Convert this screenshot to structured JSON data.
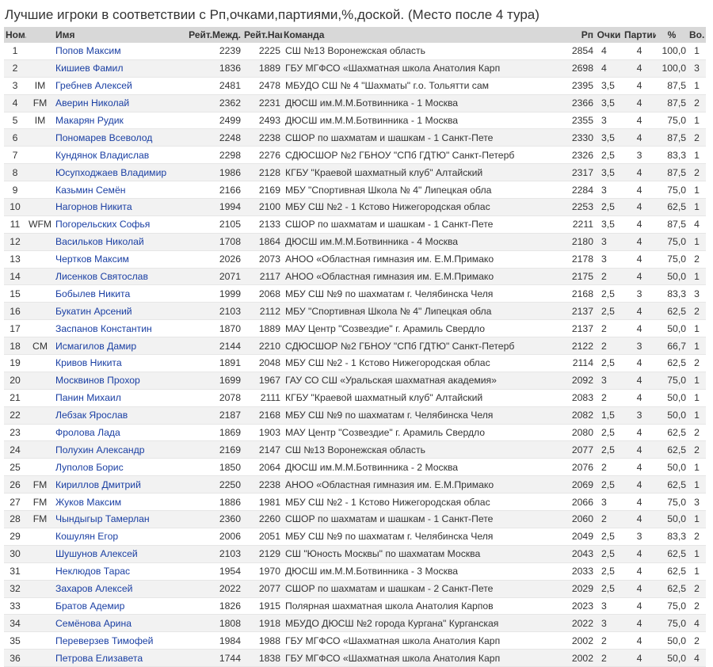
{
  "page": {
    "title": "Лучшие игроки в соответствии с Рп,очками,партиями,%,доской. (Место после 4 тура)"
  },
  "table": {
    "headers": {
      "num": "Ном.",
      "name": "Имя",
      "rating_int": "Рейт.Межд.",
      "rating_nat": "Рейт.Нац.",
      "team": "Команда",
      "rp": "Рп",
      "points": "Очки",
      "games": "Партии",
      "pct": "%",
      "board": "Во."
    },
    "rows": [
      {
        "num": "1",
        "title": "",
        "name": "Попов Максим",
        "rint": "2239",
        "rnat": "2225",
        "team": "СШ №13 Воронежская область",
        "rp": "2854",
        "pts": "4",
        "games": "4",
        "pct": "100,0",
        "bo": "1"
      },
      {
        "num": "2",
        "title": "",
        "name": "Кишиев Фамил",
        "rint": "1836",
        "rnat": "1889",
        "team": "ГБУ МГФСО «Шахматная школа Анатолия Карп",
        "rp": "2698",
        "pts": "4",
        "games": "4",
        "pct": "100,0",
        "bo": "3"
      },
      {
        "num": "3",
        "title": "IM",
        "name": "Гребнев Алексей",
        "rint": "2481",
        "rnat": "2478",
        "team": "МБУДО СШ № 4 \"Шахматы\" г.о. Тольятти сам",
        "rp": "2395",
        "pts": "3,5",
        "games": "4",
        "pct": "87,5",
        "bo": "1"
      },
      {
        "num": "4",
        "title": "FM",
        "name": "Аверин Николай",
        "rint": "2362",
        "rnat": "2231",
        "team": "ДЮСШ им.М.М.Ботвинника - 1 Москва",
        "rp": "2366",
        "pts": "3,5",
        "games": "4",
        "pct": "87,5",
        "bo": "2"
      },
      {
        "num": "5",
        "title": "IM",
        "name": "Макарян Рудик",
        "rint": "2499",
        "rnat": "2493",
        "team": "ДЮСШ им.М.М.Ботвинника - 1 Москва",
        "rp": "2355",
        "pts": "3",
        "games": "4",
        "pct": "75,0",
        "bo": "1"
      },
      {
        "num": "6",
        "title": "",
        "name": "Пономарев Всеволод",
        "rint": "2248",
        "rnat": "2238",
        "team": "СШОР по шахматам и шашкам - 1 Санкт-Пете",
        "rp": "2330",
        "pts": "3,5",
        "games": "4",
        "pct": "87,5",
        "bo": "2"
      },
      {
        "num": "7",
        "title": "",
        "name": "Кундянок Владислав",
        "rint": "2298",
        "rnat": "2276",
        "team": "СДЮСШОР №2 ГБНОУ \"СПб ГДТЮ\" Санкт-Петерб",
        "rp": "2326",
        "pts": "2,5",
        "games": "3",
        "pct": "83,3",
        "bo": "1"
      },
      {
        "num": "8",
        "title": "",
        "name": "Юсупходжаев Владимир",
        "rint": "1986",
        "rnat": "2128",
        "team": "КГБУ \"Краевой шахматный клуб\" Алтайский",
        "rp": "2317",
        "pts": "3,5",
        "games": "4",
        "pct": "87,5",
        "bo": "2"
      },
      {
        "num": "9",
        "title": "",
        "name": "Казьмин Семён",
        "rint": "2166",
        "rnat": "2169",
        "team": "МБУ \"Спортивная Школа № 4\" Липецкая обла",
        "rp": "2284",
        "pts": "3",
        "games": "4",
        "pct": "75,0",
        "bo": "1"
      },
      {
        "num": "10",
        "title": "",
        "name": "Нагорнов Никита",
        "rint": "1994",
        "rnat": "2100",
        "team": "МБУ СШ №2 - 1 Кстово Нижегородская облас",
        "rp": "2253",
        "pts": "2,5",
        "games": "4",
        "pct": "62,5",
        "bo": "1"
      },
      {
        "num": "11",
        "title": "WFM",
        "name": "Погорельских Софья",
        "rint": "2105",
        "rnat": "2133",
        "team": "СШОР по шахматам и шашкам - 1 Санкт-Пете",
        "rp": "2211",
        "pts": "3,5",
        "games": "4",
        "pct": "87,5",
        "bo": "4"
      },
      {
        "num": "12",
        "title": "",
        "name": "Васильков Николай",
        "rint": "1708",
        "rnat": "1864",
        "team": "ДЮСШ им.М.М.Ботвинника - 4 Москва",
        "rp": "2180",
        "pts": "3",
        "games": "4",
        "pct": "75,0",
        "bo": "1"
      },
      {
        "num": "13",
        "title": "",
        "name": "Чертков Максим",
        "rint": "2026",
        "rnat": "2073",
        "team": "АНОО «Областная гимназия им. Е.М.Примако",
        "rp": "2178",
        "pts": "3",
        "games": "4",
        "pct": "75,0",
        "bo": "2"
      },
      {
        "num": "14",
        "title": "",
        "name": "Лисенков Святослав",
        "rint": "2071",
        "rnat": "2117",
        "team": "АНОО «Областная гимназия им. Е.М.Примако",
        "rp": "2175",
        "pts": "2",
        "games": "4",
        "pct": "50,0",
        "bo": "1"
      },
      {
        "num": "15",
        "title": "",
        "name": "Бобылев Никита",
        "rint": "1999",
        "rnat": "2068",
        "team": "МБУ СШ №9 по шахматам г. Челябинска Челя",
        "rp": "2168",
        "pts": "2,5",
        "games": "3",
        "pct": "83,3",
        "bo": "3"
      },
      {
        "num": "16",
        "title": "",
        "name": "Букатин Арсений",
        "rint": "2103",
        "rnat": "2112",
        "team": "МБУ \"Спортивная Школа № 4\" Липецкая обла",
        "rp": "2137",
        "pts": "2,5",
        "games": "4",
        "pct": "62,5",
        "bo": "2"
      },
      {
        "num": "17",
        "title": "",
        "name": "Заспанов Константин",
        "rint": "1870",
        "rnat": "1889",
        "team": "МАУ Центр \"Созвездие\" г. Арамиль Свердло",
        "rp": "2137",
        "pts": "2",
        "games": "4",
        "pct": "50,0",
        "bo": "1"
      },
      {
        "num": "18",
        "title": "CM",
        "name": "Исмагилов Дамир",
        "rint": "2144",
        "rnat": "2210",
        "team": "СДЮСШОР №2 ГБНОУ \"СПб ГДТЮ\" Санкт-Петерб",
        "rp": "2122",
        "pts": "2",
        "games": "3",
        "pct": "66,7",
        "bo": "1"
      },
      {
        "num": "19",
        "title": "",
        "name": "Кривов Никита",
        "rint": "1891",
        "rnat": "2048",
        "team": "МБУ СШ №2 - 1 Кстово Нижегородская облас",
        "rp": "2114",
        "pts": "2,5",
        "games": "4",
        "pct": "62,5",
        "bo": "2"
      },
      {
        "num": "20",
        "title": "",
        "name": "Москвинов Прохор",
        "rint": "1699",
        "rnat": "1967",
        "team": "ГАУ СО СШ «Уральская шахматная академия»",
        "rp": "2092",
        "pts": "3",
        "games": "4",
        "pct": "75,0",
        "bo": "1"
      },
      {
        "num": "21",
        "title": "",
        "name": "Панин Михаил",
        "rint": "2078",
        "rnat": "2111",
        "team": "КГБУ \"Краевой шахматный клуб\" Алтайский",
        "rp": "2083",
        "pts": "2",
        "games": "4",
        "pct": "50,0",
        "bo": "1"
      },
      {
        "num": "22",
        "title": "",
        "name": "Лебзак Ярослав",
        "rint": "2187",
        "rnat": "2168",
        "team": "МБУ СШ №9 по шахматам г. Челябинска Челя",
        "rp": "2082",
        "pts": "1,5",
        "games": "3",
        "pct": "50,0",
        "bo": "1"
      },
      {
        "num": "23",
        "title": "",
        "name": "Фролова Лада",
        "rint": "1869",
        "rnat": "1903",
        "team": "МАУ Центр \"Созвездие\" г. Арамиль Свердло",
        "rp": "2080",
        "pts": "2,5",
        "games": "4",
        "pct": "62,5",
        "bo": "2"
      },
      {
        "num": "24",
        "title": "",
        "name": "Полухин Александр",
        "rint": "2169",
        "rnat": "2147",
        "team": "СШ №13 Воронежская область",
        "rp": "2077",
        "pts": "2,5",
        "games": "4",
        "pct": "62,5",
        "bo": "2"
      },
      {
        "num": "25",
        "title": "",
        "name": "Луполов Борис",
        "rint": "1850",
        "rnat": "2064",
        "team": "ДЮСШ им.М.М.Ботвинника - 2 Москва",
        "rp": "2076",
        "pts": "2",
        "games": "4",
        "pct": "50,0",
        "bo": "1"
      },
      {
        "num": "26",
        "title": "FM",
        "name": "Кириллов Дмитрий",
        "rint": "2250",
        "rnat": "2238",
        "team": "АНОО «Областная гимназия им. Е.М.Примако",
        "rp": "2069",
        "pts": "2,5",
        "games": "4",
        "pct": "62,5",
        "bo": "1"
      },
      {
        "num": "27",
        "title": "FM",
        "name": "Жуков Максим",
        "rint": "1886",
        "rnat": "1981",
        "team": "МБУ СШ №2 - 1 Кстово Нижегородская облас",
        "rp": "2066",
        "pts": "3",
        "games": "4",
        "pct": "75,0",
        "bo": "3"
      },
      {
        "num": "28",
        "title": "FM",
        "name": "Чындыгыр Тамерлан",
        "rint": "2360",
        "rnat": "2260",
        "team": "СШОР по шахматам и шашкам - 1 Санкт-Пете",
        "rp": "2060",
        "pts": "2",
        "games": "4",
        "pct": "50,0",
        "bo": "1"
      },
      {
        "num": "29",
        "title": "",
        "name": "Кошулян Егор",
        "rint": "2006",
        "rnat": "2051",
        "team": "МБУ СШ №9 по шахматам г. Челябинска Челя",
        "rp": "2049",
        "pts": "2,5",
        "games": "3",
        "pct": "83,3",
        "bo": "2"
      },
      {
        "num": "30",
        "title": "",
        "name": "Шушунов Алексей",
        "rint": "2103",
        "rnat": "2129",
        "team": "СШ \"Юность Москвы\" по шахматам Москва",
        "rp": "2043",
        "pts": "2,5",
        "games": "4",
        "pct": "62,5",
        "bo": "1"
      },
      {
        "num": "31",
        "title": "",
        "name": "Неклюдов Тарас",
        "rint": "1954",
        "rnat": "1970",
        "team": "ДЮСШ им.М.М.Ботвинника - 3 Москва",
        "rp": "2033",
        "pts": "2,5",
        "games": "4",
        "pct": "62,5",
        "bo": "1"
      },
      {
        "num": "32",
        "title": "",
        "name": "Захаров Алексей",
        "rint": "2022",
        "rnat": "2077",
        "team": "СШОР по шахматам и шашкам - 2 Санкт-Пете",
        "rp": "2029",
        "pts": "2,5",
        "games": "4",
        "pct": "62,5",
        "bo": "2"
      },
      {
        "num": "33",
        "title": "",
        "name": "Братов Адемир",
        "rint": "1826",
        "rnat": "1915",
        "team": "Полярная шахматная школа Анатолия Карпов",
        "rp": "2023",
        "pts": "3",
        "games": "4",
        "pct": "75,0",
        "bo": "2"
      },
      {
        "num": "34",
        "title": "",
        "name": "Семёнова Арина",
        "rint": "1808",
        "rnat": "1918",
        "team": "МБУДО ДЮСШ №2 города Кургана\" Курганская",
        "rp": "2022",
        "pts": "3",
        "games": "4",
        "pct": "75,0",
        "bo": "4"
      },
      {
        "num": "35",
        "title": "",
        "name": "Переверзев Тимофей",
        "rint": "1984",
        "rnat": "1988",
        "team": "ГБУ МГФСО «Шахматная школа Анатолия Карп",
        "rp": "2002",
        "pts": "2",
        "games": "4",
        "pct": "50,0",
        "bo": "2"
      },
      {
        "num": "36",
        "title": "",
        "name": "Петрова Елизавета",
        "rint": "1744",
        "rnat": "1838",
        "team": "ГБУ МГФСО «Шахматная школа Анатолия Карп",
        "rp": "2002",
        "pts": "2",
        "games": "4",
        "pct": "50,0",
        "bo": "4"
      }
    ]
  }
}
